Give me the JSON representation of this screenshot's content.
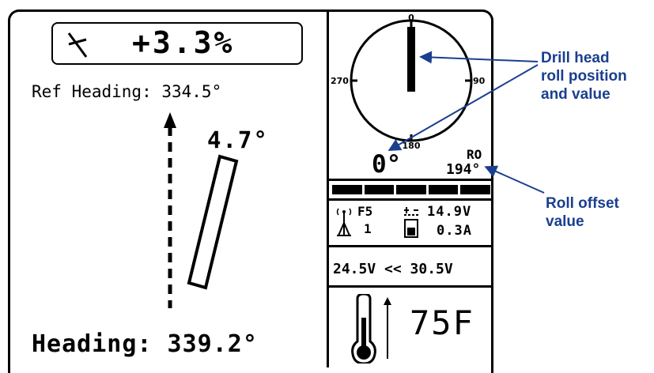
{
  "display": {
    "pitch": {
      "icon": "pitch-icon",
      "value": "+3.3%"
    },
    "ref_heading": "Ref Heading: 334.5°",
    "tool_angle": "4.7°",
    "heading": "Heading: 339.2°",
    "roll_dial": {
      "tick_top": "0",
      "tick_right": "90",
      "tick_bottom": "180",
      "tick_left": "270",
      "roll_position": 0
    },
    "roll_value": "0°",
    "roll_offset_label": "RO",
    "roll_offset_value": "194°",
    "signal_strength_bars": {
      "filled": 5,
      "total": 5
    },
    "frequency_label": "F5",
    "channel_value": "1",
    "battery_voltage": "14.9V",
    "current_draw": "0.3A",
    "voltage_range": "24.5V << 30.5V",
    "temperature": "75F",
    "icons": [
      "pitch-icon",
      "antenna-icon",
      "battery-icon",
      "thermometer-icon",
      "direction-arrow-icon"
    ]
  },
  "annotations": {
    "roll": [
      "Drill head",
      "roll position",
      "and value"
    ],
    "offset": [
      "Roll offset",
      "value"
    ],
    "color": "#1a3f8f"
  }
}
